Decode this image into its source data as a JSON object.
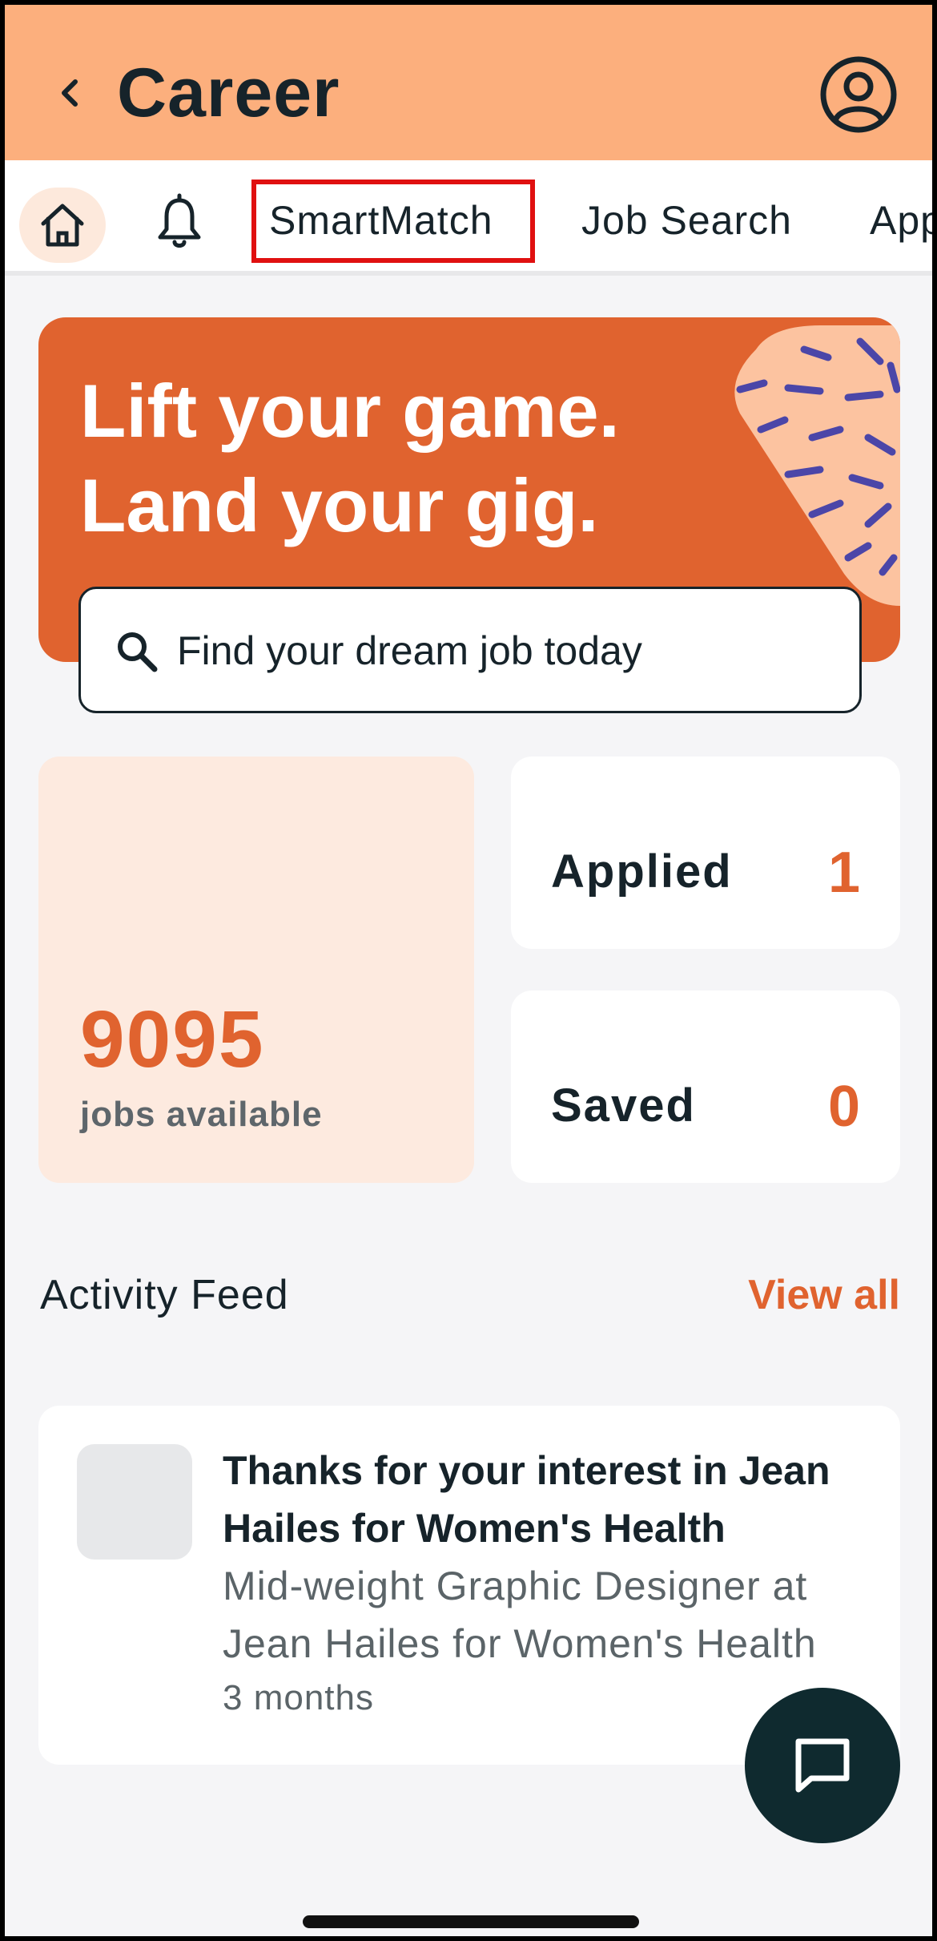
{
  "header": {
    "title": "Career"
  },
  "tabs": {
    "items": [
      "SmartMatch",
      "Job Search",
      "App"
    ],
    "selected_highlight": "SmartMatch"
  },
  "hero": {
    "line1": "Lift your game.",
    "line2": "Land your gig.",
    "search_placeholder": "Find your dream job today"
  },
  "stats": {
    "jobs_count": "9095",
    "jobs_label": "jobs available",
    "applied_label": "Applied",
    "applied_value": "1",
    "saved_label": "Saved",
    "saved_value": "0"
  },
  "feed": {
    "title": "Activity Feed",
    "view_all": "View all",
    "item": {
      "heading_line1": "Thanks for your interest in Jean",
      "heading_line2": "Hailes for Women's Health",
      "sub_line1": "Mid-weight Graphic Designer at",
      "sub_line2": "Jean Hailes for Women's Health",
      "time": "3 months"
    }
  },
  "icons": {
    "back": "chevron-left-icon",
    "profile": "user-circle-icon",
    "home": "home-icon",
    "bell": "bell-icon",
    "search": "search-icon",
    "chat": "chat-icon"
  },
  "colors": {
    "header_bg": "#fcaf7d",
    "accent": "#e0632f",
    "dark": "#16232a",
    "highlight_box": "#e01010"
  }
}
